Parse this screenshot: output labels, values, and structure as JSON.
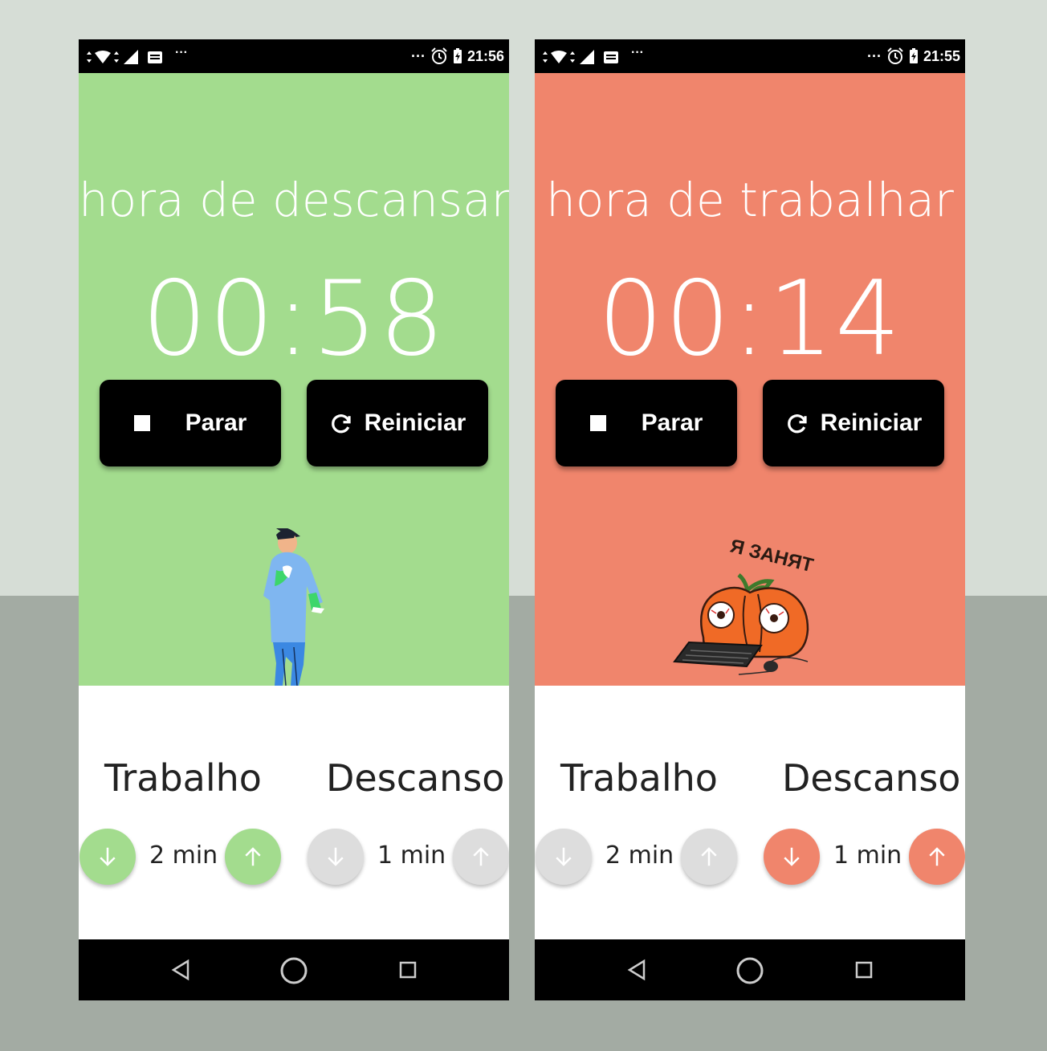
{
  "colors": {
    "rest_bg": "#a3dc8e",
    "work_bg": "#f0856c",
    "rest_accent": "#a3dc8e",
    "work_accent": "#f0856c",
    "inactive": "#dddddd"
  },
  "phones": [
    {
      "status_time": "21:56",
      "heading": "hora de descansar",
      "timer": "00:58",
      "stop_label": "Parar",
      "restart_label": "Reiniciar",
      "work_label": "Trabalho",
      "work_amount": "2 min",
      "rest_label": "Descanso",
      "rest_amount": "1 min",
      "active_section": "work",
      "illustration": "dancing-man"
    },
    {
      "status_time": "21:55",
      "heading": "hora de trabalhar",
      "timer": "00:14",
      "stop_label": "Parar",
      "restart_label": "Reiniciar",
      "work_label": "Trabalho",
      "work_amount": "2 min",
      "rest_label": "Descanso",
      "rest_amount": "1 min",
      "active_section": "rest",
      "illustration": "busy-pumpkin",
      "sticker_text": "Я ЗАНЯТ"
    }
  ]
}
